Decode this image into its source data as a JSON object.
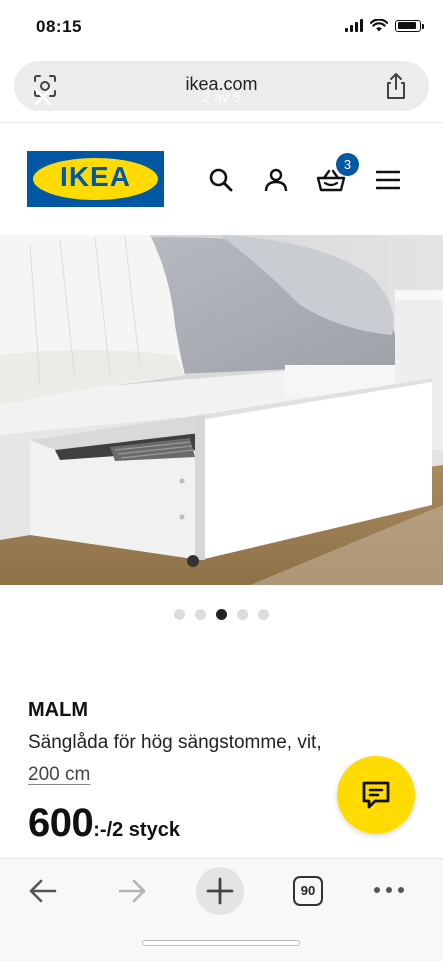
{
  "status_bar": {
    "time": "08:15",
    "battery_percent": 90
  },
  "browser": {
    "url": "ikea.com",
    "overlay_text": "2 av 5"
  },
  "header": {
    "logo_text": "IKEA",
    "cart_count": "3",
    "icons": [
      "search-icon",
      "account-icon",
      "basket-icon",
      "menu-icon"
    ]
  },
  "gallery": {
    "image_count": 5,
    "active_index": 2
  },
  "product": {
    "name": "MALM",
    "description": "Sänglåda för hög sängstomme, vit,",
    "size": "200 cm",
    "price": "600",
    "price_suffix": ":-/2 styck"
  },
  "toolbar": {
    "tab_count": "90",
    "icons": [
      "back-arrow-icon",
      "forward-arrow-icon",
      "new-tab-plus-icon",
      "tabs-icon",
      "more-icon"
    ]
  },
  "colors": {
    "ikea_blue": "#0058a3",
    "ikea_yellow": "#ffdb00",
    "url_bar_bg": "#ececee"
  }
}
